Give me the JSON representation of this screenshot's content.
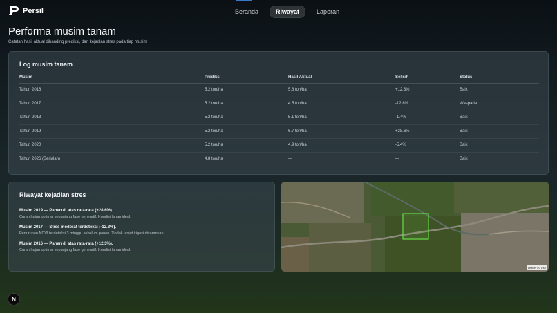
{
  "brand": {
    "name": "Persil"
  },
  "nav": {
    "items": [
      "Beranda",
      "Riwayat",
      "Laporan"
    ]
  },
  "page": {
    "title": "Performa musim tanam",
    "subtitle": "Catatan hasil aktual dibanding prediksi, dan kejadian stres pada tiap musim"
  },
  "log": {
    "title": "Log musim tanam",
    "columns": [
      "Musim",
      "Prediksi",
      "Hasil Aktual",
      "Selisih",
      "Status"
    ],
    "rows": [
      {
        "musim": "Tahun 2016",
        "prediksi": "5.2 ton/ha",
        "aktual": "5.8 ton/ha",
        "selisih": "+12.3%",
        "status": "Baik"
      },
      {
        "musim": "Tahun 2017",
        "prediksi": "5.2 ton/ha",
        "aktual": "4.5 ton/ha",
        "selisih": "-12.8%",
        "status": "Waspada"
      },
      {
        "musim": "Tahun 2018",
        "prediksi": "5.2 ton/ha",
        "aktual": "5.1 ton/ha",
        "selisih": "-1.4%",
        "status": "Baik"
      },
      {
        "musim": "Tahun 2019",
        "prediksi": "5.2 ton/ha",
        "aktual": "6.7 ton/ha",
        "selisih": "+28.6%",
        "status": "Baik"
      },
      {
        "musim": "Tahun 2020",
        "prediksi": "5.2 ton/ha",
        "aktual": "4.9 ton/ha",
        "selisih": "-5.4%",
        "status": "Baik"
      },
      {
        "musim": "Tahun 2026 (Berjalan)",
        "prediksi": "4.8 ton/ha",
        "aktual": "—",
        "selisih": "—",
        "status": "Baik"
      }
    ]
  },
  "stress": {
    "title": "Riwayat kejadian stres",
    "events": [
      {
        "title": "Musim 2019 — Panen di atas rata-rata (+28.6%).",
        "desc": "Curah hujan optimal sepanjang fase generatif. Kondisi lahan ideal."
      },
      {
        "title": "Musim 2017 — Stres moderat terdeteksi (-12.8%).",
        "desc": "Penurunan NDVI terdeteksi 3 minggu sebelum panen. Tindak lanjut irigasi disarankan."
      },
      {
        "title": "Musim 2016 — Panen di atas rata-rata (+12.3%).",
        "desc": "Curah hujan optimal sepanjang fase generatif. Kondisi lahan ideal."
      }
    ]
  },
  "map": {
    "attribution": "Leaflet | © Esri"
  },
  "dev": {
    "badge": "N"
  },
  "colors": {
    "positive": "#35d25a",
    "negative": "#ef4a4a",
    "warning": "#f0b23c",
    "accent": "#3a78c9"
  }
}
